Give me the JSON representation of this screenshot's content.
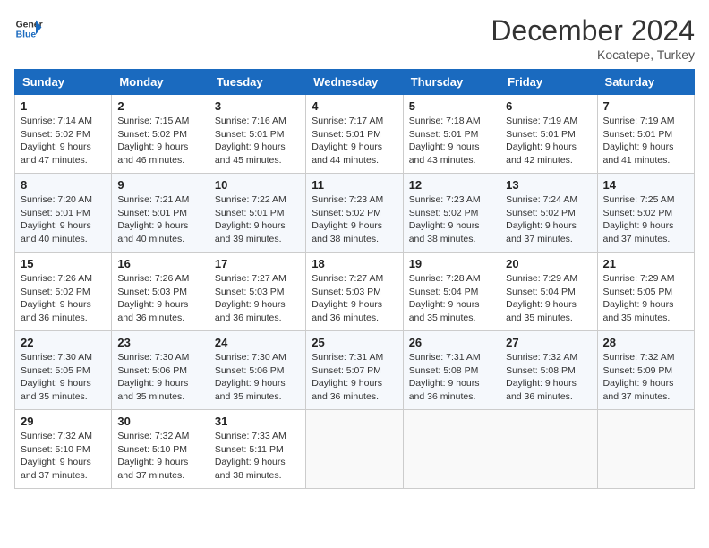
{
  "header": {
    "logo_line1": "General",
    "logo_line2": "Blue",
    "month_title": "December 2024",
    "location": "Kocatepe, Turkey"
  },
  "days_of_week": [
    "Sunday",
    "Monday",
    "Tuesday",
    "Wednesday",
    "Thursday",
    "Friday",
    "Saturday"
  ],
  "weeks": [
    [
      {
        "day": "1",
        "sunrise": "Sunrise: 7:14 AM",
        "sunset": "Sunset: 5:02 PM",
        "daylight": "Daylight: 9 hours and 47 minutes."
      },
      {
        "day": "2",
        "sunrise": "Sunrise: 7:15 AM",
        "sunset": "Sunset: 5:02 PM",
        "daylight": "Daylight: 9 hours and 46 minutes."
      },
      {
        "day": "3",
        "sunrise": "Sunrise: 7:16 AM",
        "sunset": "Sunset: 5:01 PM",
        "daylight": "Daylight: 9 hours and 45 minutes."
      },
      {
        "day": "4",
        "sunrise": "Sunrise: 7:17 AM",
        "sunset": "Sunset: 5:01 PM",
        "daylight": "Daylight: 9 hours and 44 minutes."
      },
      {
        "day": "5",
        "sunrise": "Sunrise: 7:18 AM",
        "sunset": "Sunset: 5:01 PM",
        "daylight": "Daylight: 9 hours and 43 minutes."
      },
      {
        "day": "6",
        "sunrise": "Sunrise: 7:19 AM",
        "sunset": "Sunset: 5:01 PM",
        "daylight": "Daylight: 9 hours and 42 minutes."
      },
      {
        "day": "7",
        "sunrise": "Sunrise: 7:19 AM",
        "sunset": "Sunset: 5:01 PM",
        "daylight": "Daylight: 9 hours and 41 minutes."
      }
    ],
    [
      {
        "day": "8",
        "sunrise": "Sunrise: 7:20 AM",
        "sunset": "Sunset: 5:01 PM",
        "daylight": "Daylight: 9 hours and 40 minutes."
      },
      {
        "day": "9",
        "sunrise": "Sunrise: 7:21 AM",
        "sunset": "Sunset: 5:01 PM",
        "daylight": "Daylight: 9 hours and 40 minutes."
      },
      {
        "day": "10",
        "sunrise": "Sunrise: 7:22 AM",
        "sunset": "Sunset: 5:01 PM",
        "daylight": "Daylight: 9 hours and 39 minutes."
      },
      {
        "day": "11",
        "sunrise": "Sunrise: 7:23 AM",
        "sunset": "Sunset: 5:02 PM",
        "daylight": "Daylight: 9 hours and 38 minutes."
      },
      {
        "day": "12",
        "sunrise": "Sunrise: 7:23 AM",
        "sunset": "Sunset: 5:02 PM",
        "daylight": "Daylight: 9 hours and 38 minutes."
      },
      {
        "day": "13",
        "sunrise": "Sunrise: 7:24 AM",
        "sunset": "Sunset: 5:02 PM",
        "daylight": "Daylight: 9 hours and 37 minutes."
      },
      {
        "day": "14",
        "sunrise": "Sunrise: 7:25 AM",
        "sunset": "Sunset: 5:02 PM",
        "daylight": "Daylight: 9 hours and 37 minutes."
      }
    ],
    [
      {
        "day": "15",
        "sunrise": "Sunrise: 7:26 AM",
        "sunset": "Sunset: 5:02 PM",
        "daylight": "Daylight: 9 hours and 36 minutes."
      },
      {
        "day": "16",
        "sunrise": "Sunrise: 7:26 AM",
        "sunset": "Sunset: 5:03 PM",
        "daylight": "Daylight: 9 hours and 36 minutes."
      },
      {
        "day": "17",
        "sunrise": "Sunrise: 7:27 AM",
        "sunset": "Sunset: 5:03 PM",
        "daylight": "Daylight: 9 hours and 36 minutes."
      },
      {
        "day": "18",
        "sunrise": "Sunrise: 7:27 AM",
        "sunset": "Sunset: 5:03 PM",
        "daylight": "Daylight: 9 hours and 36 minutes."
      },
      {
        "day": "19",
        "sunrise": "Sunrise: 7:28 AM",
        "sunset": "Sunset: 5:04 PM",
        "daylight": "Daylight: 9 hours and 35 minutes."
      },
      {
        "day": "20",
        "sunrise": "Sunrise: 7:29 AM",
        "sunset": "Sunset: 5:04 PM",
        "daylight": "Daylight: 9 hours and 35 minutes."
      },
      {
        "day": "21",
        "sunrise": "Sunrise: 7:29 AM",
        "sunset": "Sunset: 5:05 PM",
        "daylight": "Daylight: 9 hours and 35 minutes."
      }
    ],
    [
      {
        "day": "22",
        "sunrise": "Sunrise: 7:30 AM",
        "sunset": "Sunset: 5:05 PM",
        "daylight": "Daylight: 9 hours and 35 minutes."
      },
      {
        "day": "23",
        "sunrise": "Sunrise: 7:30 AM",
        "sunset": "Sunset: 5:06 PM",
        "daylight": "Daylight: 9 hours and 35 minutes."
      },
      {
        "day": "24",
        "sunrise": "Sunrise: 7:30 AM",
        "sunset": "Sunset: 5:06 PM",
        "daylight": "Daylight: 9 hours and 35 minutes."
      },
      {
        "day": "25",
        "sunrise": "Sunrise: 7:31 AM",
        "sunset": "Sunset: 5:07 PM",
        "daylight": "Daylight: 9 hours and 36 minutes."
      },
      {
        "day": "26",
        "sunrise": "Sunrise: 7:31 AM",
        "sunset": "Sunset: 5:08 PM",
        "daylight": "Daylight: 9 hours and 36 minutes."
      },
      {
        "day": "27",
        "sunrise": "Sunrise: 7:32 AM",
        "sunset": "Sunset: 5:08 PM",
        "daylight": "Daylight: 9 hours and 36 minutes."
      },
      {
        "day": "28",
        "sunrise": "Sunrise: 7:32 AM",
        "sunset": "Sunset: 5:09 PM",
        "daylight": "Daylight: 9 hours and 37 minutes."
      }
    ],
    [
      {
        "day": "29",
        "sunrise": "Sunrise: 7:32 AM",
        "sunset": "Sunset: 5:10 PM",
        "daylight": "Daylight: 9 hours and 37 minutes."
      },
      {
        "day": "30",
        "sunrise": "Sunrise: 7:32 AM",
        "sunset": "Sunset: 5:10 PM",
        "daylight": "Daylight: 9 hours and 37 minutes."
      },
      {
        "day": "31",
        "sunrise": "Sunrise: 7:33 AM",
        "sunset": "Sunset: 5:11 PM",
        "daylight": "Daylight: 9 hours and 38 minutes."
      },
      null,
      null,
      null,
      null
    ]
  ]
}
